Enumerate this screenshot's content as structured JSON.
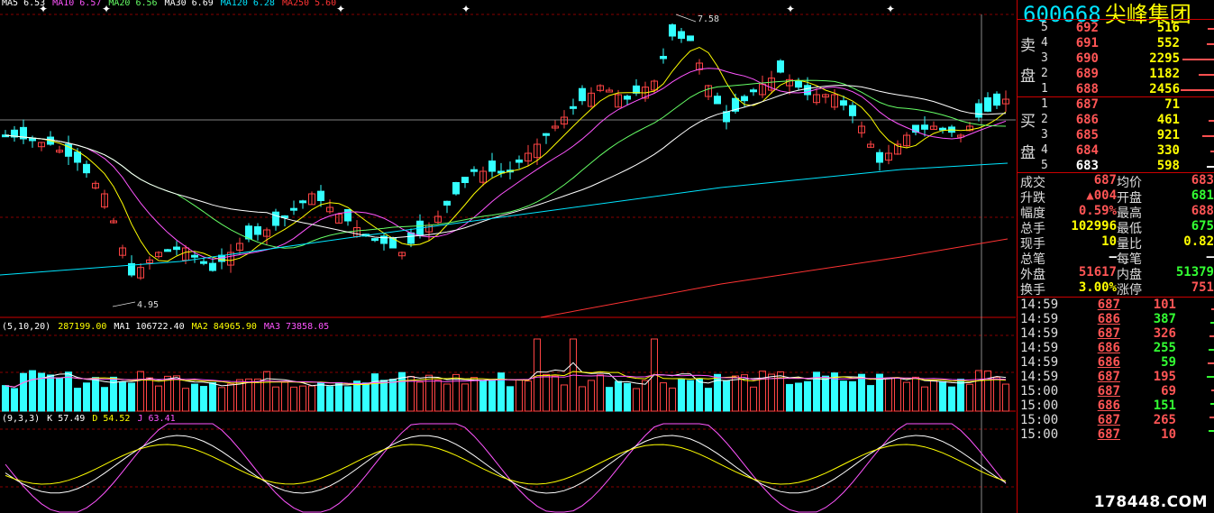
{
  "stock": {
    "code": "600668",
    "name": "尖峰集团"
  },
  "ma_legend": [
    {
      "label": "MA5 6.53",
      "color": "#ffffff"
    },
    {
      "label": "MA10 6.57",
      "color": "#ff55ff"
    },
    {
      "label": "MA20 6.56",
      "color": "#66ff66"
    },
    {
      "label": "MA30 6.69",
      "color": "#ffffff"
    },
    {
      "label": "MA120 6.28",
      "color": "#00e5ff"
    },
    {
      "label": "MA250 5.60",
      "color": "#ff3333"
    }
  ],
  "price_annotations": {
    "high": "7.58",
    "low": "4.95"
  },
  "volume_legend": [
    {
      "label": "(5,10,20)",
      "color": "#ffffff"
    },
    {
      "label": "287199.00",
      "color": "#ffff00"
    },
    {
      "label": "MA1 106722.40",
      "color": "#ffffff"
    },
    {
      "label": "MA2 84965.90",
      "color": "#ffff00"
    },
    {
      "label": "MA3 73858.05",
      "color": "#ff55ff"
    }
  ],
  "kdj_legend": [
    {
      "label": "(9,3,3)",
      "color": "#ffffff"
    },
    {
      "label": "K 57.49",
      "color": "#ffffff"
    },
    {
      "label": "D 54.52",
      "color": "#ffff00"
    },
    {
      "label": "J 63.41",
      "color": "#ff55ff"
    }
  ],
  "colors": {
    "up": "#ff4444",
    "down": "#33ffff",
    "text_up": "#ff5555",
    "text_down": "#33ff33",
    "text_even": "#ffffff",
    "yellow": "#ffff00"
  },
  "order_book": {
    "sell_label_1": "卖",
    "sell_label_2": "盘",
    "buy_label_1": "买",
    "buy_label_2": "盘",
    "sell": [
      {
        "level": "5",
        "price": "692",
        "volume": "516",
        "bar": 0.2
      },
      {
        "level": "4",
        "price": "691",
        "volume": "552",
        "bar": 0.22
      },
      {
        "level": "3",
        "price": "690",
        "volume": "2295",
        "bar": 0.9
      },
      {
        "level": "2",
        "price": "689",
        "volume": "1182",
        "bar": 0.46
      },
      {
        "level": "1",
        "price": "688",
        "volume": "2456",
        "bar": 0.96
      }
    ],
    "buy": [
      {
        "level": "1",
        "price": "687",
        "volume": "71",
        "bar": 0.03
      },
      {
        "level": "2",
        "price": "686",
        "volume": "461",
        "bar": 0.18
      },
      {
        "level": "3",
        "price": "685",
        "volume": "921",
        "bar": 0.36
      },
      {
        "level": "4",
        "price": "684",
        "volume": "330",
        "bar": 0.13
      },
      {
        "level": "5",
        "price": "683",
        "volume": "598",
        "bar": 0.23
      }
    ]
  },
  "quote": [
    {
      "l1": "成交",
      "v1": "687",
      "c1": "up",
      "l2": "均价",
      "v2": "683",
      "c2": "up"
    },
    {
      "l1": "升跌",
      "v1": "▲004",
      "c1": "up",
      "l2": "开盘",
      "v2": "681",
      "c2": "down"
    },
    {
      "l1": "幅度",
      "v1": "0.59%",
      "c1": "up",
      "l2": "最高",
      "v2": "688",
      "c2": "up"
    },
    {
      "l1": "总手",
      "v1": "102996",
      "c1": "yellow",
      "l2": "最低",
      "v2": "675",
      "c2": "down"
    },
    {
      "l1": "现手",
      "v1": "10",
      "c1": "yellow",
      "l2": "量比",
      "v2": "0.82",
      "c2": "yellow"
    },
    {
      "l1": "总笔",
      "v1": "—",
      "c1": "even",
      "l2": "每笔",
      "v2": "—",
      "c2": "even"
    },
    {
      "l1": "外盘",
      "v1": "51617",
      "c1": "up",
      "l2": "内盘",
      "v2": "51379",
      "c2": "down"
    },
    {
      "l1": "换手",
      "v1": "3.00%",
      "c1": "yellow",
      "l2": "涨停",
      "v2": "751",
      "c2": "up"
    }
  ],
  "ticks": [
    {
      "time": "14:59",
      "price": "687",
      "volume": "101",
      "dir": "up"
    },
    {
      "time": "14:59",
      "price": "686",
      "volume": "387",
      "dir": "down"
    },
    {
      "time": "14:59",
      "price": "687",
      "volume": "326",
      "dir": "up"
    },
    {
      "time": "14:59",
      "price": "686",
      "volume": "255",
      "dir": "down"
    },
    {
      "time": "14:59",
      "price": "686",
      "volume": "59",
      "dir": "down"
    },
    {
      "time": "14:59",
      "price": "687",
      "volume": "195",
      "dir": "up"
    },
    {
      "time": "15:00",
      "price": "687",
      "volume": "69",
      "dir": "up"
    },
    {
      "time": "15:00",
      "price": "686",
      "volume": "151",
      "dir": "down"
    },
    {
      "time": "15:00",
      "price": "687",
      "volume": "265",
      "dir": "up"
    },
    {
      "time": "15:00",
      "price": "687",
      "volume": "10",
      "dir": "up"
    }
  ],
  "watermark": "178448.COM"
}
